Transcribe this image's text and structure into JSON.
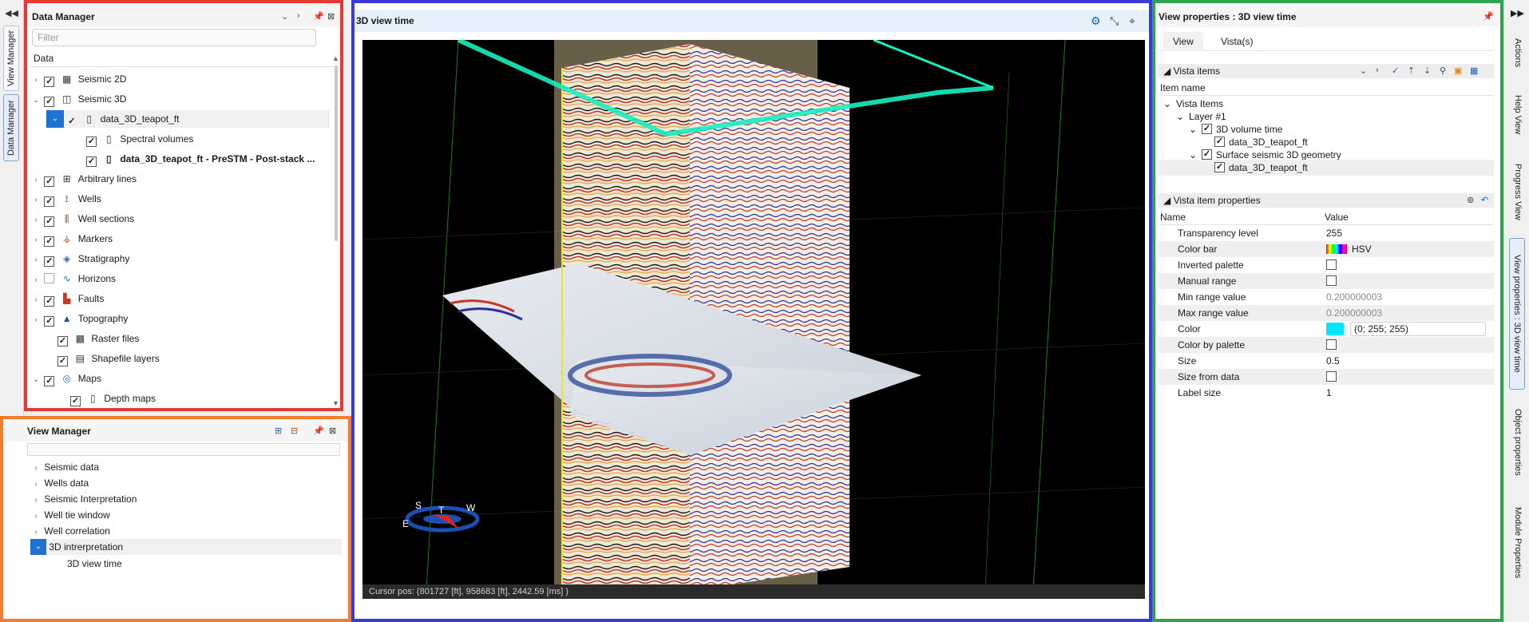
{
  "left_rail": {
    "tabs": [
      "View Manager",
      "Data Manager"
    ]
  },
  "data_manager": {
    "title": "Data Manager",
    "filter_placeholder": "Filter",
    "column_header": "Data",
    "items": [
      {
        "label": "Seismic 2D",
        "icon": "seismic-2d-icon",
        "checked": true,
        "expanded": false
      },
      {
        "label": "Seismic 3D",
        "icon": "seismic-3d-icon",
        "checked": true,
        "expanded": true
      },
      {
        "label": "data_3D_teapot_ft",
        "icon": "file-icon",
        "checked": true,
        "expanded": true
      },
      {
        "label": "Spectral volumes",
        "icon": "file-icon",
        "checked": true
      },
      {
        "label": "data_3D_teapot_ft - PreSTM - Post-stack ...",
        "icon": "file-icon",
        "checked": true
      },
      {
        "label": "Arbitrary lines",
        "icon": "arbitrary-lines-icon",
        "checked": true
      },
      {
        "label": "Wells",
        "icon": "well-icon",
        "checked": true
      },
      {
        "label": "Well sections",
        "icon": "well-sections-icon",
        "checked": true
      },
      {
        "label": "Markers",
        "icon": "markers-icon",
        "checked": true
      },
      {
        "label": "Stratigraphy",
        "icon": "stratigraphy-icon",
        "checked": true
      },
      {
        "label": "Horizons",
        "icon": "horizons-icon",
        "checked": false
      },
      {
        "label": "Faults",
        "icon": "faults-icon",
        "checked": true
      },
      {
        "label": "Topography",
        "icon": "topography-icon",
        "checked": true
      },
      {
        "label": "Raster files",
        "icon": "raster-icon",
        "checked": true
      },
      {
        "label": "Shapefile layers",
        "icon": "shapefile-icon",
        "checked": true
      },
      {
        "label": "Maps",
        "icon": "maps-icon",
        "checked": true,
        "expanded": true
      },
      {
        "label": "Depth maps",
        "icon": "file-icon",
        "checked": true
      }
    ]
  },
  "view_manager": {
    "title": "View Manager",
    "items": [
      "Seismic data",
      "Wells data",
      "Seismic Interpretation",
      "Well tie window",
      "Well correlation",
      "3D intrerpretation",
      "3D view time"
    ]
  },
  "view_3d": {
    "title": "3D view time",
    "cursor_pos": "Cursor pos: (801727 [ft], 958683 [ft], 2442.59 [ms] )",
    "compass": {
      "S": "S",
      "T": "T",
      "W": "W",
      "E": "E"
    }
  },
  "view_properties": {
    "title": "View properties : 3D view time",
    "tabs": [
      "View",
      "Vista(s)"
    ],
    "vista_items_section": "Vista items",
    "item_name_header": "Item name",
    "tree": {
      "root": "Vista Items",
      "layer": "Layer #1",
      "vol": "3D volume time",
      "vol_child": "data_3D_teapot_ft",
      "surf": "Surface seismic 3D geometry",
      "surf_child": "data_3D_teapot_ft"
    },
    "props_section": "Vista item properties",
    "col_name": "Name",
    "col_value": "Value",
    "properties": [
      {
        "name": "Transparency level",
        "value": "255"
      },
      {
        "name": "Color bar",
        "value": "HSV"
      },
      {
        "name": "Inverted palette",
        "value": ""
      },
      {
        "name": "Manual range",
        "value": ""
      },
      {
        "name": "Min range value",
        "value": "0.200000003"
      },
      {
        "name": "Max range value",
        "value": "0.200000003"
      },
      {
        "name": "Color",
        "value": "(0; 255; 255)"
      },
      {
        "name": "Color by palette",
        "value": ""
      },
      {
        "name": "Size",
        "value": "0.5"
      },
      {
        "name": "Size from data",
        "value": ""
      },
      {
        "name": "Label size",
        "value": "1"
      }
    ],
    "color_swatch": "#00e5ff"
  },
  "right_rail": {
    "tabs": [
      "Actions",
      "Help View",
      "Progress View",
      "View properties : 3D view time",
      "Object properties",
      "Module Properties"
    ]
  }
}
